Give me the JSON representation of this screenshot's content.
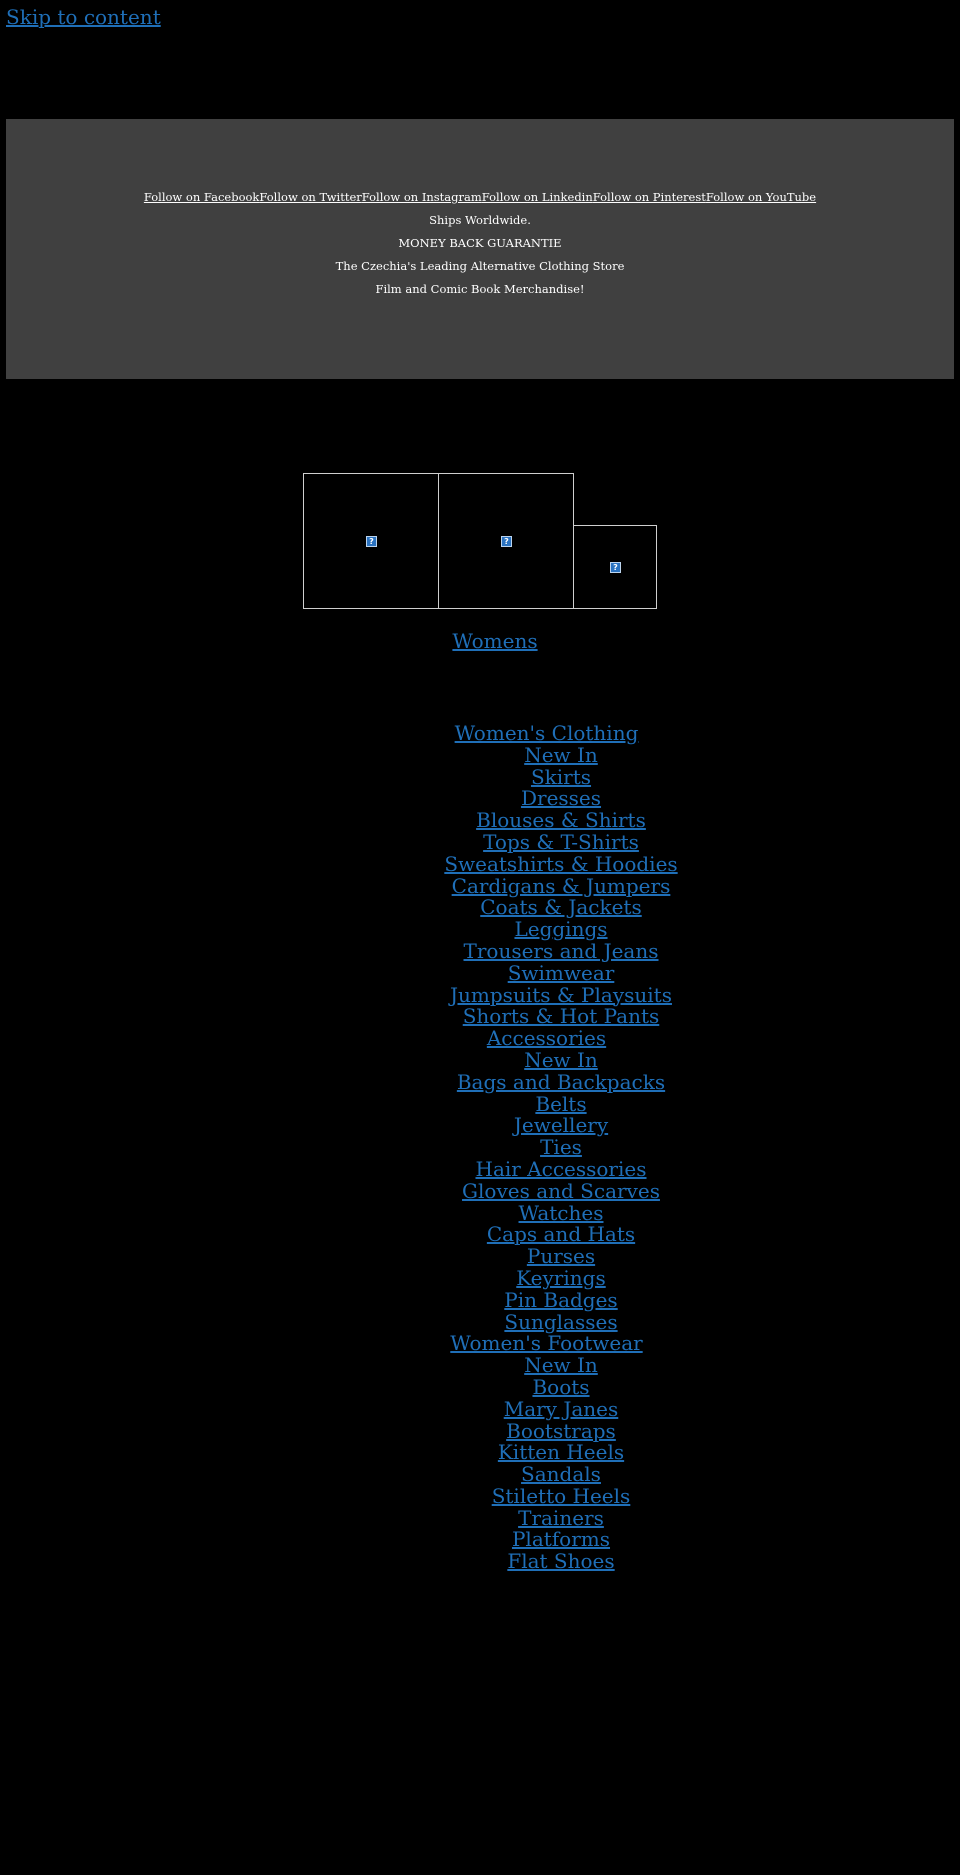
{
  "skip_link": "Skip to content",
  "banner": {
    "social_links": [
      "Follow on Facebook",
      "Follow on Twitter",
      "Follow on Instagram",
      "Follow on Linkedin",
      "Follow on Pinterest",
      "Follow on YouTube"
    ],
    "lines": [
      "Ships Worldwide.",
      "MONEY BACK GUARANTIE",
      "The Czechia's Leading Alternative Clothing Store",
      "Film and Comic Book Merchandise!"
    ],
    "background": "#404040"
  },
  "gallery": {
    "images": [
      {
        "icon": "broken-image-icon",
        "glyph": "?"
      },
      {
        "icon": "broken-image-icon",
        "glyph": "?"
      },
      {
        "icon": "broken-image-icon",
        "glyph": "?"
      }
    ]
  },
  "womens_link": "Womens",
  "menu": {
    "link_color": "#1f6fb8",
    "sections": [
      {
        "title": "Women's Clothing",
        "items": [
          "New In",
          "Skirts",
          "Dresses",
          "Blouses & Shirts",
          "Tops & T-Shirts",
          "Sweatshirts & Hoodies",
          "Cardigans & Jumpers",
          "Coats & Jackets",
          "Leggings",
          "Trousers and Jeans",
          "Swimwear",
          "Jumpsuits & Playsuits",
          "Shorts & Hot Pants"
        ]
      },
      {
        "title": "Accessories",
        "items": [
          "New In",
          "Bags and Backpacks",
          "Belts",
          "Jewellery",
          "Ties",
          "Hair Accessories",
          "Gloves and Scarves",
          "Watches",
          "Caps and Hats",
          "Purses",
          "Keyrings",
          "Pin Badges",
          "Sunglasses"
        ]
      },
      {
        "title": "Women's Footwear",
        "items": [
          "New In",
          "Boots",
          "Mary Janes",
          "Bootstraps",
          "Kitten Heels",
          "Sandals",
          "Stiletto Heels",
          "Trainers",
          "Platforms",
          "Flat Shoes"
        ]
      }
    ]
  }
}
